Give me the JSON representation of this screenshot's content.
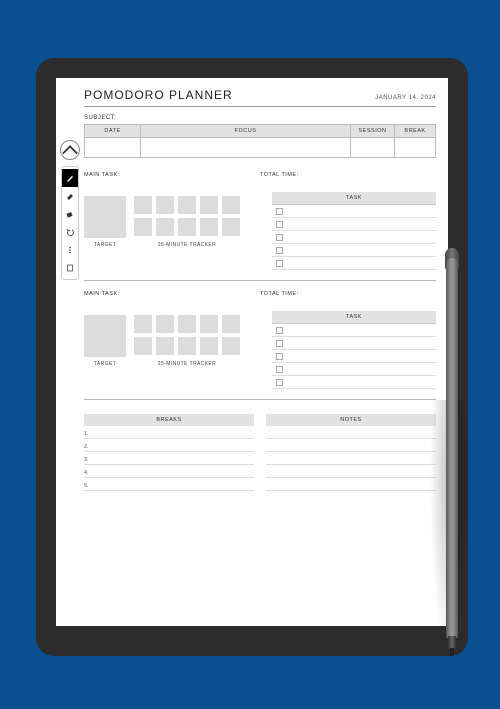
{
  "header": {
    "title": "POMODORO PLANNER",
    "date": "JANUARY 14, 2024"
  },
  "subject_label": "SUBJECT:",
  "columns": {
    "date": "DATE",
    "focus": "FOCUS",
    "session": "SESSION",
    "break": "BREAK"
  },
  "main_task_label": "MAIN TASK:",
  "total_time_label": "TOTAL TIME:",
  "task_header": "TASK",
  "target_caption": "TARGET",
  "tracker_caption": "25-MINUTE TRACKER",
  "breaks_header": "BREAKS",
  "notes_header": "NOTES",
  "break_numbers": [
    "1.",
    "2.",
    "3.",
    "4.",
    "5."
  ],
  "toolbar": {
    "items": [
      "pen",
      "highlighter",
      "eraser",
      "undo",
      "more",
      "book"
    ]
  }
}
